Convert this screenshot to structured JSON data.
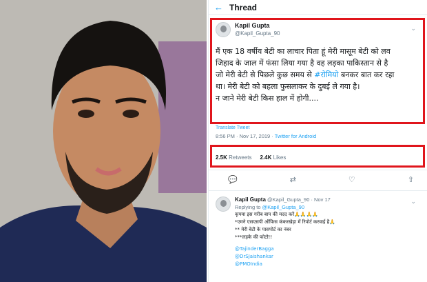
{
  "header": {
    "back_icon": "arrow-left-icon",
    "title": "Thread"
  },
  "tweet": {
    "name": "Kapil Gupta",
    "handle": "@Kapil_Gupta_90",
    "lines": [
      "मैं एक 18 वर्षीय बेटी का लाचार पिता हूं मेरी मासूम बेटी को लव",
      "जिहाद के जाल में फंसा लिया गया है वह लड़का पाकिस्तान से है",
      "जो मेरी बेटी से पिछले कुछ समय से ",
      "#रोमियो",
      " बनकर बात कर रहा",
      "था। मेरी बेटी को बहला फुसलाकर के दुबई ले गया है।",
      "न जाने मेरी बेटी किस हाल में होगी...."
    ],
    "translate": "Translate Tweet",
    "time": "8:56 PM · Nov 17, 2019 · ",
    "source": "Twitter for Android",
    "retweets": "2.5K",
    "retweets_label": "Retweets",
    "likes": "2.4K",
    "likes_label": "Likes"
  },
  "reply": {
    "name": "Kapil Gupta",
    "handle": "@Kapil_Gupta_90 · Nov 17",
    "replying_prefix": "Replying to ",
    "replying_to": "@Kapil_Gupta_90",
    "lines": [
      "कृपया इस गरीब बाप की मदद करें🙏🙏🙏🙏",
      "*एमने एसएसपी ऑफिस कंकरखेड़ा में रिपोर्ट करवाई है🙏",
      "** मेरी बेटी के पासपोर्ट का नंबर",
      "***लड़के की फोटो!!"
    ],
    "mentions": [
      "@TajinderBagga",
      "@DrSJaishankar",
      "@PMOIndia"
    ]
  },
  "colors": {
    "highlight": "#e0151c",
    "link": "#1da1f2"
  }
}
